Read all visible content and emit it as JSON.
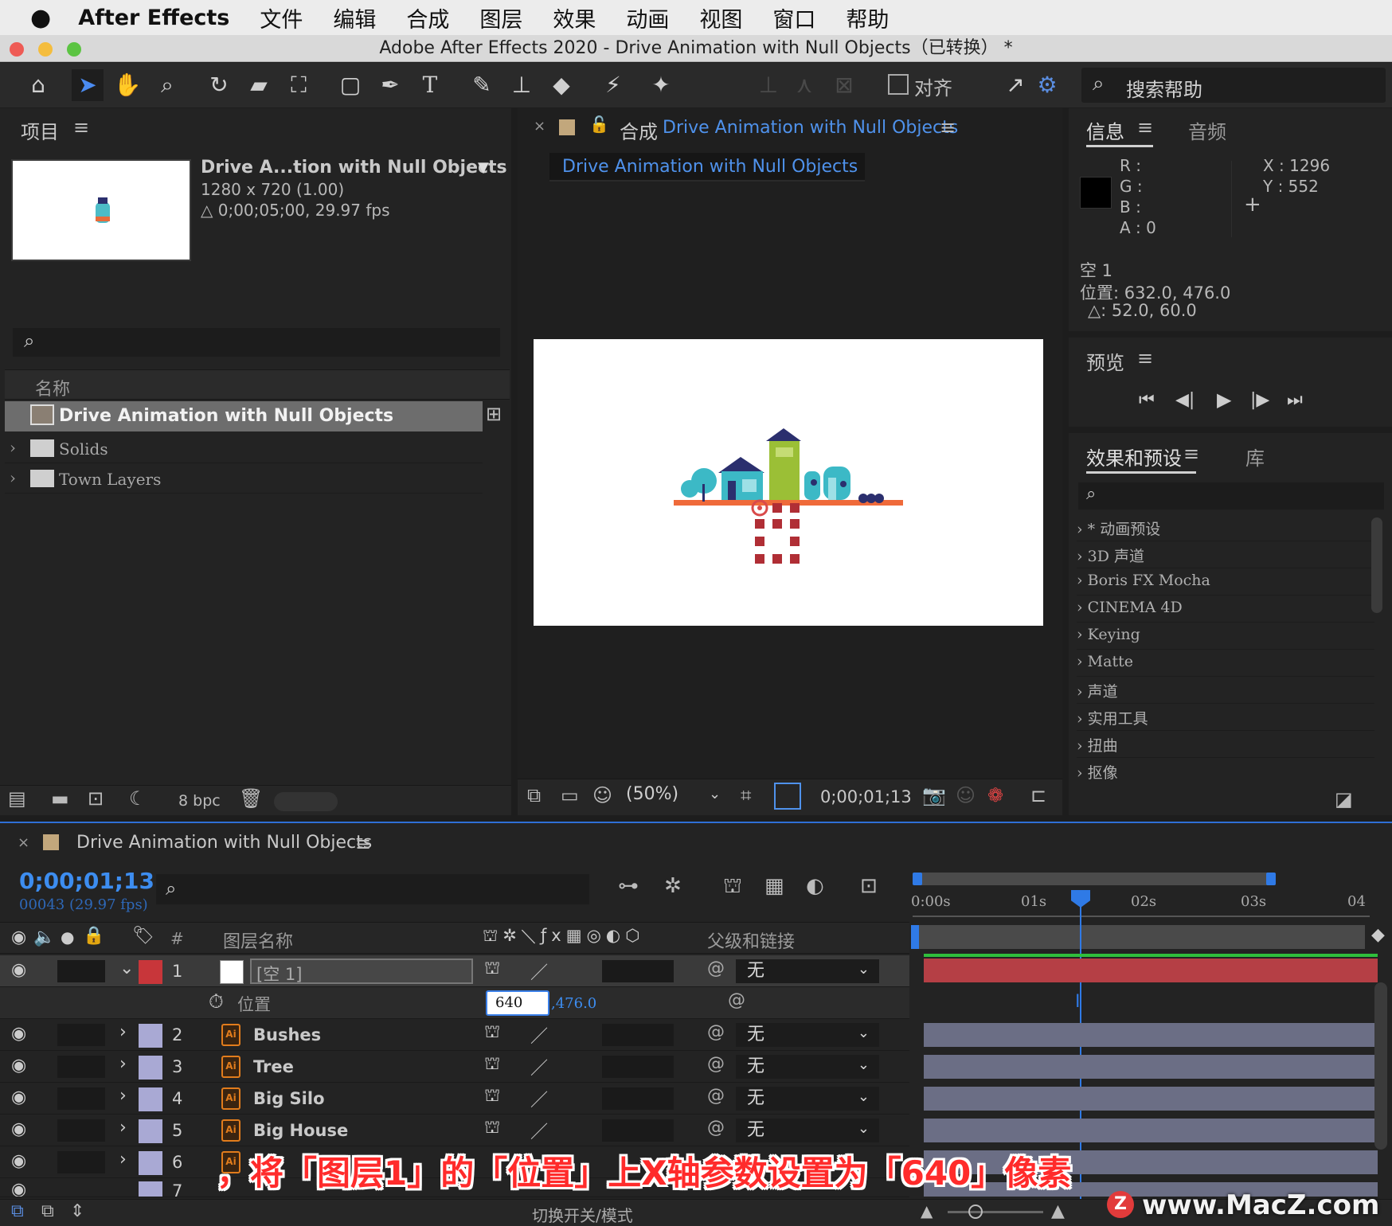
{
  "menubar": {
    "app": "After Effects",
    "items": [
      "文件",
      "编辑",
      "合成",
      "图层",
      "效果",
      "动画",
      "视图",
      "窗口",
      "帮助"
    ]
  },
  "window_title": "Adobe After Effects 2020 - Drive Animation with Null Objects（已转换） *",
  "toolbar": {
    "align_label": "对齐",
    "search_placeholder": "搜索帮助"
  },
  "project": {
    "title": "项目",
    "comp_name": "Drive A...tion with Null Objects",
    "comp_size": "1280 x 720 (1.00)",
    "comp_duration": "△ 0;00;05;00, 29.97 fps",
    "column_name": "名称",
    "items": [
      {
        "name": "Drive Animation with Null Objects",
        "type": "comp"
      },
      {
        "name": "Solids",
        "type": "folder"
      },
      {
        "name": "Town Layers",
        "type": "folder"
      }
    ],
    "bpc": "8 bpc"
  },
  "composition": {
    "title_prefix": "合成",
    "title_name": "Drive Animation with Null Objects",
    "tab": "Drive Animation with Null Objects",
    "zoom": "(50%)",
    "timecode": "0;00;01;13"
  },
  "info": {
    "tab_info": "信息",
    "tab_audio": "音频",
    "r": "R :",
    "g": "G :",
    "b": "B :",
    "a": "A :  0",
    "x": "X : 1296",
    "y": "Y :  552",
    "layer": "空 1",
    "position": "位置: 632.0, 476.0",
    "delta": "△: 52.0, 60.0"
  },
  "preview": {
    "title": "预览"
  },
  "effects": {
    "tab_effects": "效果和预设",
    "tab_library": "库",
    "items": [
      "* 动画预设",
      "3D 声道",
      "Boris FX Mocha",
      "CINEMA 4D",
      "Keying",
      "Matte",
      "声道",
      "实用工具",
      "扭曲",
      "抠像"
    ]
  },
  "timeline": {
    "title": "Drive Animation with Null Objects",
    "timecode": "0;00;01;13",
    "frame_info": "00043 (29.97 fps)",
    "col_num": "#",
    "col_layer_name": "图层名称",
    "col_parent": "父级和链接",
    "ruler": [
      "0:00s",
      "01s",
      "02s",
      "03s",
      "04"
    ],
    "playhead_seconds": 1.43,
    "layers": [
      {
        "num": "1",
        "name": "[空 1]",
        "color": "#c8363a",
        "parent": "无"
      },
      {
        "num": "2",
        "name": "Bushes",
        "color": "#a9a9d4",
        "parent": "无"
      },
      {
        "num": "3",
        "name": "Tree",
        "color": "#a9a9d4",
        "parent": "无"
      },
      {
        "num": "4",
        "name": "Big Silo",
        "color": "#a9a9d4",
        "parent": "无"
      },
      {
        "num": "5",
        "name": "Big House",
        "color": "#a9a9d4",
        "parent": "无"
      },
      {
        "num": "6",
        "name": "",
        "color": "#a9a9d4",
        "parent": ""
      },
      {
        "num": "7",
        "name": "",
        "color": "#a9a9d4",
        "parent": ""
      }
    ],
    "property_name": "位置",
    "property_x": "640",
    "property_y": ",476.0",
    "toggle_label": "切换开关/模式"
  },
  "overlay": {
    "caption": "，将「图层1」的「位置」上X轴参数设置为「640」像素",
    "watermark": "www.MacZ.com"
  }
}
